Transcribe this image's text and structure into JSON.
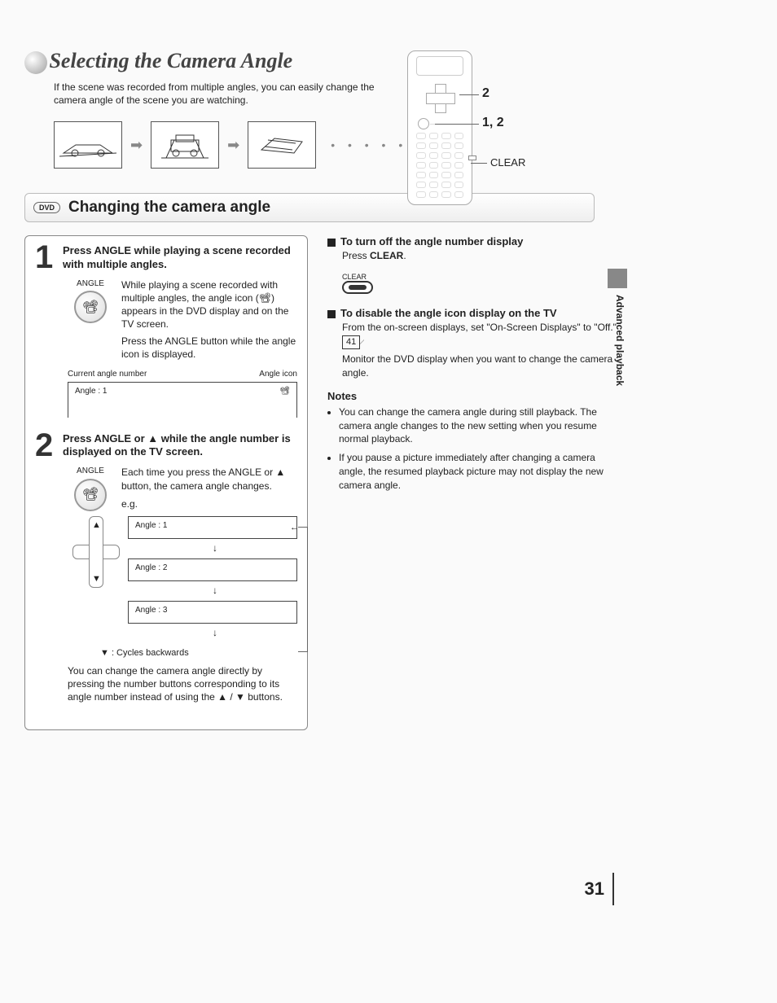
{
  "title": "Selecting the Camera Angle",
  "intro": "If the scene was recorded from multiple angles, you can easily change the camera angle of the scene you are watching.",
  "remote_callouts": {
    "dpad": "2",
    "angle": "1, 2",
    "clear": "CLEAR"
  },
  "section": {
    "badge": "DVD",
    "heading": "Changing the camera angle"
  },
  "step1": {
    "num": "1",
    "title": "Press ANGLE while playing a scene recorded with multiple angles.",
    "btn_label": "ANGLE",
    "body1": "While playing a scene recorded with multiple angles, the angle icon (📽) appears in the DVD display and on the TV screen.",
    "body2": "Press the ANGLE button while the angle icon is displayed.",
    "label_left": "Current angle number",
    "label_right": "Angle icon",
    "display_text": "Angle : 1"
  },
  "step2": {
    "num": "2",
    "title": "Press ANGLE or ▲ while the angle number is displayed on the TV screen.",
    "btn_label": "ANGLE",
    "body": "Each time you press the ANGLE or ▲ button, the camera angle changes.",
    "eg": "e.g.",
    "boxes": [
      "Angle : 1",
      "Angle : 2",
      "Angle : 3"
    ],
    "cycles": "▼ : Cycles backwards",
    "note": "You can change the camera angle directly by pressing the number buttons corresponding to its angle number instead of using the ▲ / ▼ buttons."
  },
  "right": {
    "h1": "To turn off the angle number display",
    "h1_body_prefix": "Press ",
    "h1_body_bold": "CLEAR",
    "clear_label": "CLEAR",
    "h2": "To disable the angle icon display on the TV",
    "h2_body1a": "From the on-screen displays, set \"On-Screen Displays\" to \"Off.\" ",
    "h2_ref": "41",
    "h2_body2": "Monitor the DVD display when you want to change the camera angle.",
    "notes_head": "Notes",
    "notes": [
      "You can change the camera angle during still playback. The camera angle changes to the new setting when you resume normal playback.",
      "If you pause a picture immediately after changing a camera angle, the resumed playback picture may not display the new camera angle."
    ]
  },
  "side_tab": "Advanced playback",
  "page_number": "31"
}
